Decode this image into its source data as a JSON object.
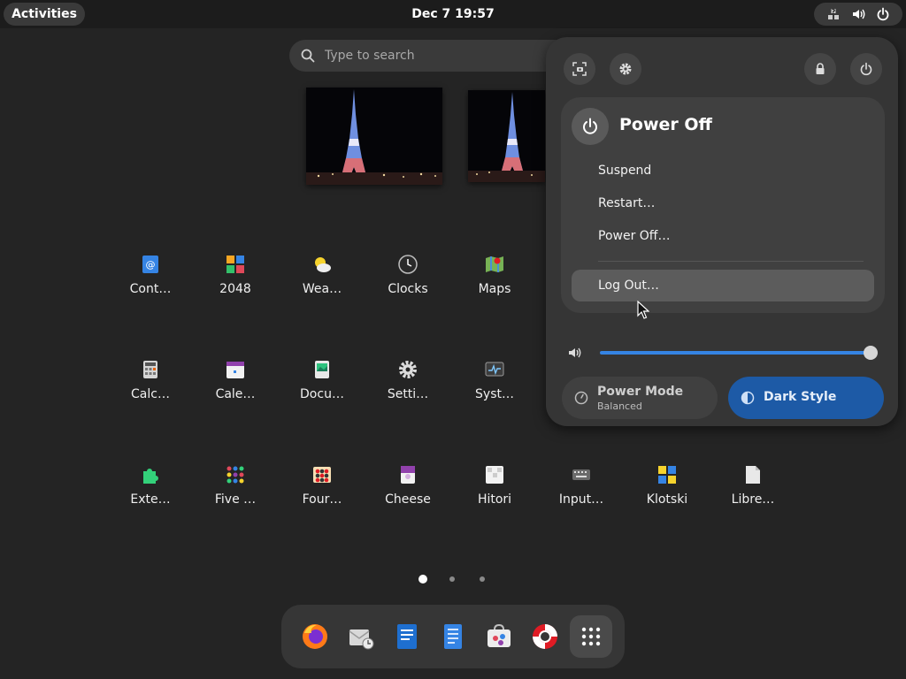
{
  "topbar": {
    "activities_label": "Activities",
    "clock": "Dec 7  19:57"
  },
  "search": {
    "placeholder": "Type to search"
  },
  "apps": [
    {
      "label": "Cont…",
      "icon": "contacts-icon"
    },
    {
      "label": "2048",
      "icon": "2048-icon"
    },
    {
      "label": "Wea…",
      "icon": "weather-icon"
    },
    {
      "label": "Clocks",
      "icon": "clocks-icon"
    },
    {
      "label": "Maps",
      "icon": "maps-icon"
    },
    {
      "label": "Calc…",
      "icon": "calculator-icon"
    },
    {
      "label": "Cale…",
      "icon": "calendar-icon"
    },
    {
      "label": "Docu…",
      "icon": "document-viewer-icon"
    },
    {
      "label": "Setti…",
      "icon": "settings-icon"
    },
    {
      "label": "Syst…",
      "icon": "system-monitor-icon"
    },
    {
      "label": "Exte…",
      "icon": "extensions-icon"
    },
    {
      "label": "Five …",
      "icon": "five-or-more-icon"
    },
    {
      "label": "Four…",
      "icon": "four-in-a-row-icon"
    },
    {
      "label": "Cheese",
      "icon": "cheese-icon"
    },
    {
      "label": "Hitori",
      "icon": "hitori-icon"
    },
    {
      "label": "Input…",
      "icon": "input-method-icon"
    },
    {
      "label": "Klotski",
      "icon": "klotski-icon"
    },
    {
      "label": "Libre…",
      "icon": "libreoffice-icon"
    }
  ],
  "dash": [
    "firefox-icon",
    "evolution-icon",
    "writer-icon",
    "text-editor-icon",
    "software-icon",
    "help-icon",
    "show-apps-icon"
  ],
  "quick_settings": {
    "power_menu": {
      "title": "Power Off",
      "items": [
        "Suspend",
        "Restart…",
        "Power Off…",
        "Log Out…"
      ]
    },
    "volume_level": 1.0,
    "power_mode": {
      "title": "Power Mode",
      "subtitle": "Balanced"
    },
    "dark_style": {
      "title": "Dark Style",
      "active": true
    },
    "colors": {
      "accent": "#3584e4",
      "toggle_active": "#1d5aa6"
    }
  }
}
